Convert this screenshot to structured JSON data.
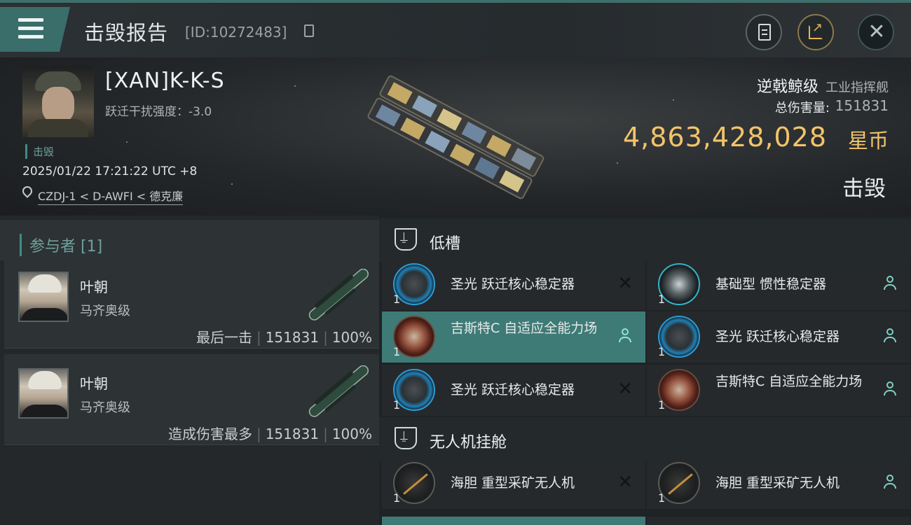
{
  "header": {
    "title": "击毁报告",
    "report_id": "[ID:10272483]"
  },
  "victim": {
    "pilot_name": "[XAN]K-K-S",
    "warp_scramble": "跃迁干扰强度：-3.0",
    "tag": "击毁",
    "datetime": "2025/01/22 17:21:22 UTC +8",
    "location": "CZDJ-1 < D-AWFI < 德克廉",
    "ship_class": "逆戟鲸级",
    "ship_type": "工业指挥舰",
    "damage_label": "总伤害量:",
    "damage_value": "151831",
    "isk_value": "4,863,428,028",
    "isk_unit": "星币",
    "result": "击毁"
  },
  "participants": {
    "title": "参与者 [1]",
    "items": [
      {
        "name": "叶朝",
        "ship": "马齐奥级",
        "role": "最后一击",
        "damage": "151831",
        "percent": "100%"
      },
      {
        "name": "叶朝",
        "ship": "马齐奥级",
        "role": "造成伤害最多",
        "damage": "151831",
        "percent": "100%"
      }
    ]
  },
  "sections": {
    "low_slots": "低槽",
    "drone_bay": "无人机挂舱"
  },
  "modules": [
    {
      "qty": "1",
      "name": "圣光 跃迁核心稳定器",
      "status": "destroyed",
      "icon": "warp-core-stabilizer-icon"
    },
    {
      "qty": "1",
      "name": "基础型 惯性稳定器",
      "status": "dropped",
      "icon": "inertial-stabilizer-icon"
    },
    {
      "qty": "1",
      "name": "吉斯特C 自适应全能力场",
      "status": "dropped",
      "icon": "adaptive-invulnerability-field-icon"
    },
    {
      "qty": "1",
      "name": "圣光 跃迁核心稳定器",
      "status": "dropped",
      "icon": "warp-core-stabilizer-icon"
    },
    {
      "qty": "1",
      "name": "圣光 跃迁核心稳定器",
      "status": "destroyed",
      "icon": "warp-core-stabilizer-icon"
    },
    {
      "qty": "1",
      "name": "吉斯特C 自适应全能力场",
      "status": "dropped",
      "icon": "adaptive-invulnerability-field-icon"
    },
    {
      "qty": "1",
      "name": "海胆 重型采矿无人机",
      "status": "destroyed",
      "icon": "mining-drone-icon"
    },
    {
      "qty": "1",
      "name": "海胆 重型采矿无人机",
      "status": "dropped",
      "icon": "mining-drone-icon"
    }
  ],
  "colors": {
    "accent_teal": "#3f7b76",
    "isk_gold": "#f2c46a",
    "dropped_icon": "#7fd1c6"
  }
}
